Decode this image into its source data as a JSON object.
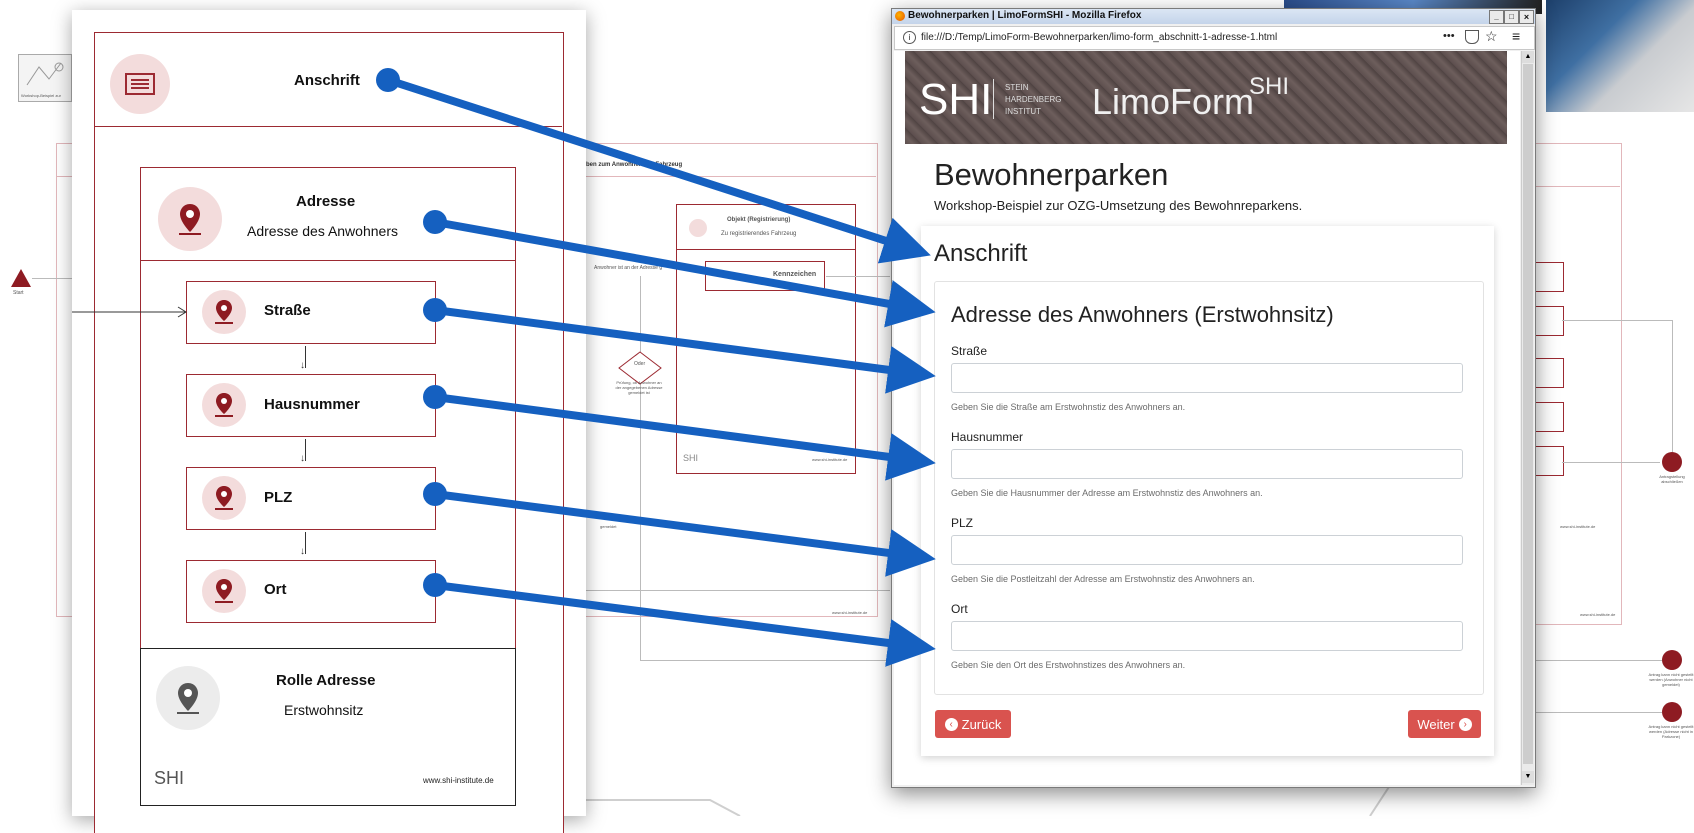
{
  "background": {
    "thumbnail_caption": "Workshop-Beispiel zur",
    "start_label": "Start",
    "header_snippet": "ben zum Anwohner und Fahrzeug",
    "object_title": "Objekt (Registrierung)",
    "object_subtitle": "Zu registrierendes Fahrzeug",
    "kennzeichen_label": "Kennzeichen",
    "arrow_label": "Anwohner ist an der Adresse g",
    "oder_label": "Oder",
    "pruefung_label": "Prüfung, ob Anwohner an der angegebenen Adresse gemeldet ist",
    "gemeldet_label": "gemeldet",
    "shi_small": "SHI",
    "website_small": "www.shi-institute.de",
    "antrag_abschliessen": "Antragstellung abschließen",
    "antrag_nicht_1": "Antrag kann nicht gestellt werden (Anwohner nicht gemeldet)",
    "antrag_nicht_2": "Antrag kann nicht gestellt werden (Adresse nicht in Parkzone)"
  },
  "diagram": {
    "anschrift": "Anschrift",
    "adresse_title": "Adresse",
    "adresse_subtitle": "Adresse des Anwohners",
    "strasse": "Straße",
    "hausnummer": "Hausnummer",
    "plz": "PLZ",
    "ort": "Ort",
    "rolle_title": "Rolle Adresse",
    "rolle_value": "Erstwohnsitz",
    "shi_logo": "SHI",
    "website": "www.shi-institute.de"
  },
  "browser": {
    "window_title": "Bewohnerparken | LimoFormSHI - Mozilla Firefox",
    "url": "file:///D:/Temp/LimoForm-Bewohnerparken/limo-form_abschnitt-1-adresse-1.html",
    "url_menu": "•••",
    "banner": {
      "shi": "SHI",
      "stein": "STEIN",
      "hardenberg": "HARDENBERG",
      "institut": "INSTITUT",
      "product": "LimoForm",
      "product_sup": "SHI"
    },
    "page_title": "Bewohnerparken",
    "page_subtitle": "Workshop-Beispiel zur OZG-Umsetzung des Bewohnreparkens.",
    "section_title": "Anschrift",
    "group_title": "Adresse des Anwohners (Erstwohnsitz)",
    "fields": [
      {
        "label": "Straße",
        "help": "Geben Sie die Straße am Erstwohnstiz des Anwohners an."
      },
      {
        "label": "Hausnummer",
        "help": "Geben Sie die Hausnummer der Adresse am Erstwohnstiz des Anwohners an."
      },
      {
        "label": "PLZ",
        "help": "Geben Sie die Postleitzahl der Adresse am Erstwohnstiz des Anwohners an."
      },
      {
        "label": "Ort",
        "help": "Geben Sie den Ort des Erstwohnstizes des Anwohners an."
      }
    ],
    "back_button": "Zurück",
    "next_button": "Weiter"
  },
  "colors": {
    "dark_red": "#8e1b22",
    "button_red": "#d9534f",
    "arrow_blue": "#1560c0"
  }
}
